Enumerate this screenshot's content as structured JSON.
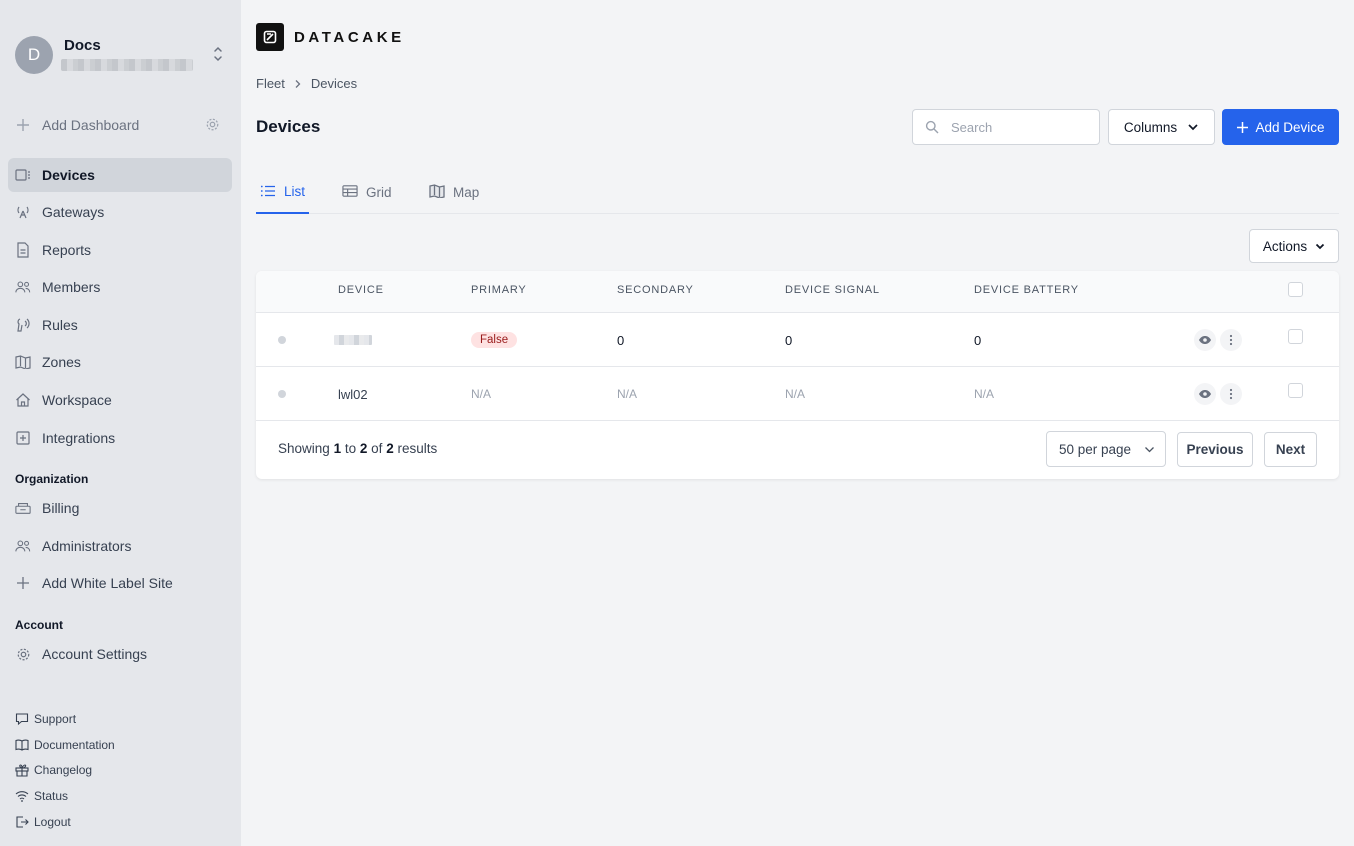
{
  "org": {
    "avatar_letter": "D",
    "name": "Docs"
  },
  "sidebar": {
    "add_dashboard": "Add Dashboard",
    "items": [
      {
        "label": "Devices",
        "icon": "devices-icon"
      },
      {
        "label": "Gateways",
        "icon": "gateway-icon"
      },
      {
        "label": "Reports",
        "icon": "report-icon"
      },
      {
        "label": "Members",
        "icon": "members-icon"
      },
      {
        "label": "Rules",
        "icon": "rules-icon"
      },
      {
        "label": "Zones",
        "icon": "map-icon"
      },
      {
        "label": "Workspace",
        "icon": "home-icon"
      },
      {
        "label": "Integrations",
        "icon": "plus-square-icon"
      }
    ],
    "organization_title": "Organization",
    "organization_items": [
      {
        "label": "Billing",
        "icon": "billing-icon"
      },
      {
        "label": "Administrators",
        "icon": "admins-icon"
      },
      {
        "label": "Add White Label Site",
        "icon": "plus-icon"
      }
    ],
    "account_title": "Account",
    "account_items": [
      {
        "label": "Account Settings",
        "icon": "gear-icon"
      }
    ],
    "footer": [
      {
        "label": "Support",
        "icon": "chat-icon"
      },
      {
        "label": "Documentation",
        "icon": "book-icon"
      },
      {
        "label": "Changelog",
        "icon": "gift-icon"
      },
      {
        "label": "Status",
        "icon": "wifi-icon"
      },
      {
        "label": "Logout",
        "icon": "logout-icon"
      }
    ]
  },
  "brand": {
    "name": "DATACAKE"
  },
  "breadcrumb": [
    "Fleet",
    "Devices"
  ],
  "page": {
    "title": "Devices"
  },
  "toolbar": {
    "search_placeholder": "Search",
    "columns_label": "Columns",
    "add_device_label": "Add Device"
  },
  "tabs": [
    {
      "label": "List",
      "active": true
    },
    {
      "label": "Grid",
      "active": false
    },
    {
      "label": "Map",
      "active": false
    }
  ],
  "actions_label": "Actions",
  "table": {
    "columns": [
      "DEVICE",
      "PRIMARY",
      "SECONDARY",
      "DEVICE SIGNAL",
      "DEVICE BATTERY"
    ],
    "rows": [
      {
        "device": "",
        "primary": "False",
        "secondary": "0",
        "signal": "0",
        "battery": "0"
      },
      {
        "device": "lwl02",
        "primary": "N/A",
        "secondary": "N/A",
        "signal": "N/A",
        "battery": "N/A"
      }
    ]
  },
  "pagination": {
    "showing_prefix": "Showing",
    "from": "1",
    "to_word": "to",
    "to": "2",
    "of_word": "of",
    "total": "2",
    "results_word": "results",
    "per_page": "50 per page",
    "previous": "Previous",
    "next": "Next"
  },
  "colors": {
    "accent": "#2563eb",
    "sidebar_bg": "#e5e7eb",
    "badge_bg": "#fee2e2",
    "badge_text": "#991b1b"
  }
}
